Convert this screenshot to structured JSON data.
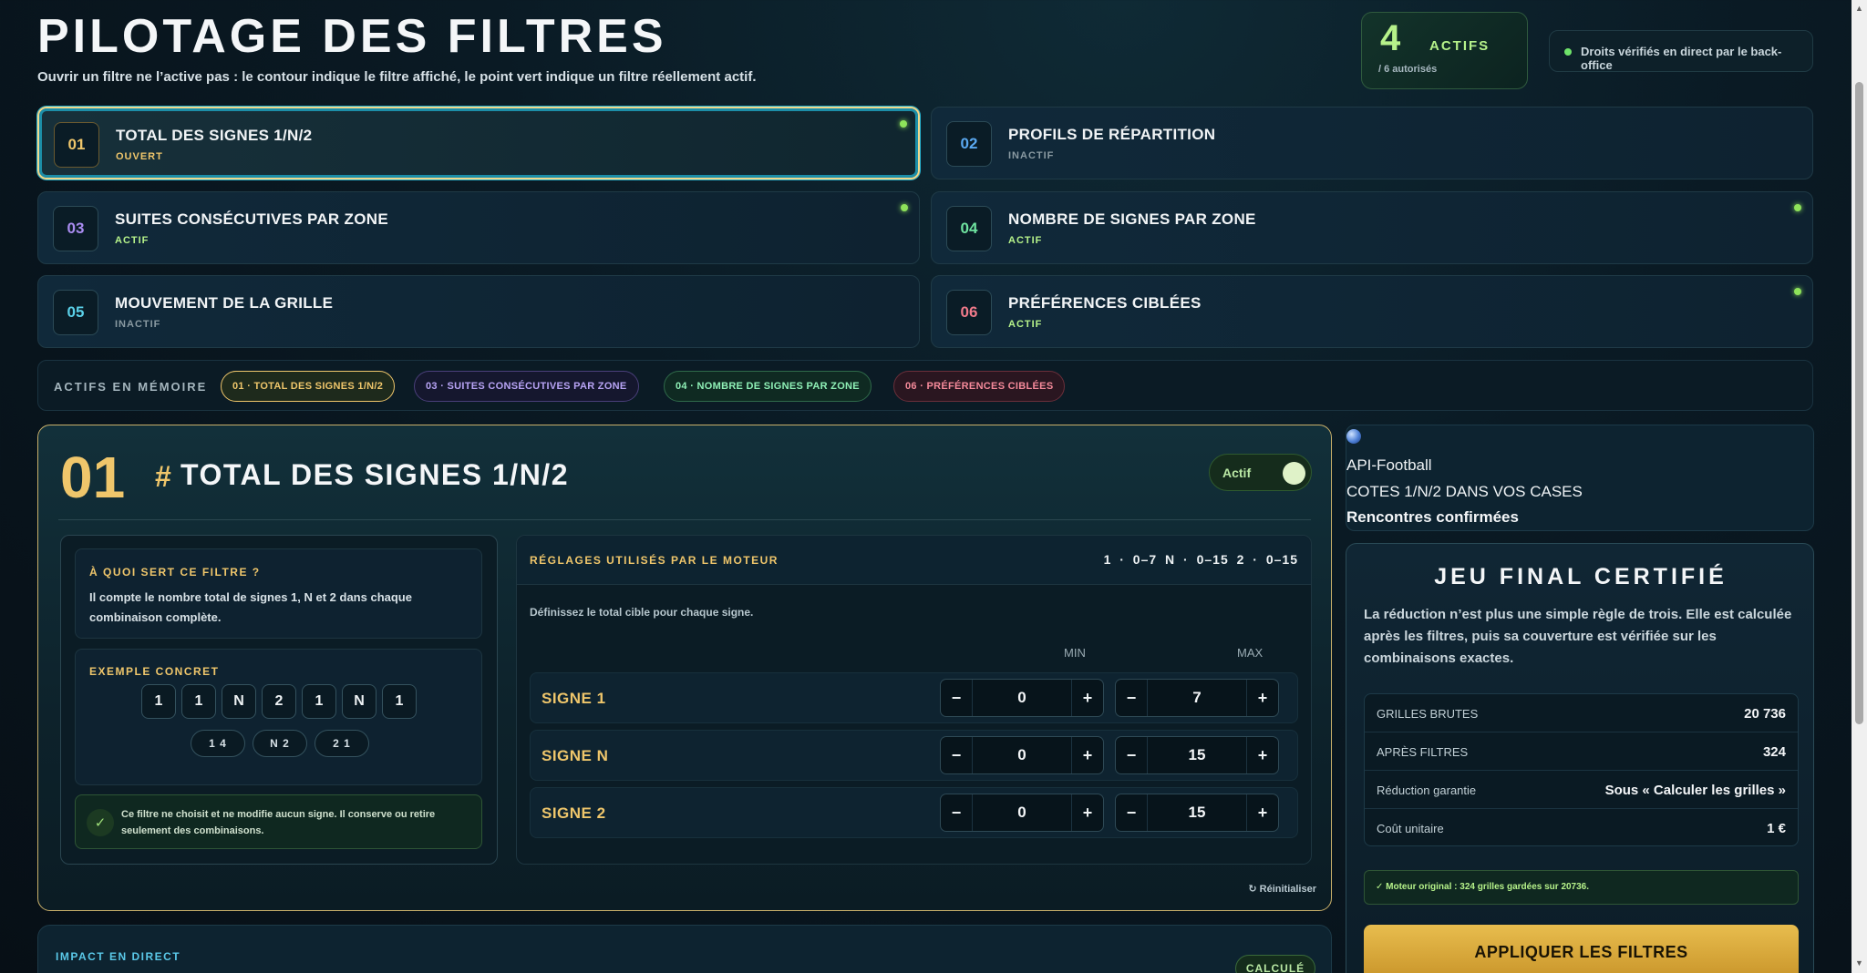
{
  "header": {
    "title": "PILOTAGE DES FILTRES",
    "subtitle": "Ouvrir un filtre ne l’active pas : le contour indique le filtre affiché, le point vert indique un filtre réellement actif.",
    "active_count": "4",
    "active_label": "ACTIFS",
    "active_sub": "/ 6 autorisés",
    "rights": "Droits vérifiés en direct par le back-office"
  },
  "filters": [
    {
      "num": "01",
      "name": "TOTAL DES SIGNES 1/N/2",
      "state": "OUVERT",
      "color": "#efc66b"
    },
    {
      "num": "02",
      "name": "PROFILS DE RÉPARTITION",
      "state": "INACTIF",
      "color": "#5aa8f0"
    },
    {
      "num": "03",
      "name": "SUITES CONSÉCUTIVES PAR ZONE",
      "state": "ACTIF",
      "color": "#a98cf0"
    },
    {
      "num": "04",
      "name": "NOMBRE DE SIGNES PAR ZONE",
      "state": "ACTIF",
      "color": "#6fe3a0"
    },
    {
      "num": "05",
      "name": "MOUVEMENT DE LA GRILLE",
      "state": "INACTIF",
      "color": "#5ad0e8"
    },
    {
      "num": "06",
      "name": "PRÉFÉRENCES CIBLÉES",
      "state": "ACTIF",
      "color": "#f07a8a"
    }
  ],
  "memory": {
    "label": "ACTIFS EN MÉMOIRE",
    "pills": [
      "01 · TOTAL DES SIGNES 1/N/2",
      "03 · SUITES CONSÉCUTIVES PAR ZONE",
      "04 · NOMBRE DE SIGNES PAR ZONE",
      "06 · PRÉFÉRENCES CIBLÉES"
    ]
  },
  "panel": {
    "num": "01",
    "hash": "#",
    "title": "TOTAL DES SIGNES 1/N/2",
    "toggle_label": "Actif",
    "purpose_title": "À QUOI SERT CE FILTRE ?",
    "purpose_text": "Il compte le nombre total de signes 1, N et 2 dans chaque combinaison complète.",
    "example_title": "EXEMPLE CONCRET",
    "example_signs": [
      "1",
      "1",
      "N",
      "2",
      "1",
      "N",
      "1"
    ],
    "example_counts": [
      "1 4",
      "N 2",
      "2 1"
    ],
    "note": "Ce filtre ne choisit et ne modifie aucun signe. Il conserve ou retire seulement des combinaisons.",
    "settings_title": "RÉGLAGES UTILISÉS PAR LE MOTEUR",
    "settings_summary": "1 · 0–7   N · 0–15   2 · 0–15",
    "settings_desc": "Définissez le total cible pour chaque signe.",
    "col_min": "MIN",
    "col_max": "MAX",
    "rows": [
      {
        "label": "SIGNE 1",
        "min": "0",
        "max": "7"
      },
      {
        "label": "SIGNE N",
        "min": "0",
        "max": "15"
      },
      {
        "label": "SIGNE 2",
        "min": "0",
        "max": "15"
      }
    ],
    "minus": "−",
    "plus": "+",
    "reset": "↻ Réinitialiser"
  },
  "impact": {
    "title": "IMPACT EN DIRECT",
    "badge": "CALCULÉ"
  },
  "api": {
    "line1": "API-Football",
    "line2": "COTES 1/N/2 DANS VOS CASES",
    "line3": "Rencontres confirmées"
  },
  "final": {
    "title": "JEU FINAL CERTIFIÉ",
    "text": "La réduction n’est plus une simple règle de trois. Elle est calculée après les filtres, puis sa couverture est vérifiée sur les combinaisons exactes.",
    "stats": [
      {
        "k": "GRILLES BRUTES",
        "v": "20 736"
      },
      {
        "k": "APRÈS FILTRES",
        "v": "324"
      },
      {
        "k": "Réduction garantie",
        "v": "Sous « Calculer les grilles »"
      },
      {
        "k": "Coût unitaire",
        "v": "1 €"
      }
    ],
    "original": "✓ Moteur original : 324 grilles gardées sur 20736.",
    "apply": "APPLIQUER LES FILTRES"
  }
}
